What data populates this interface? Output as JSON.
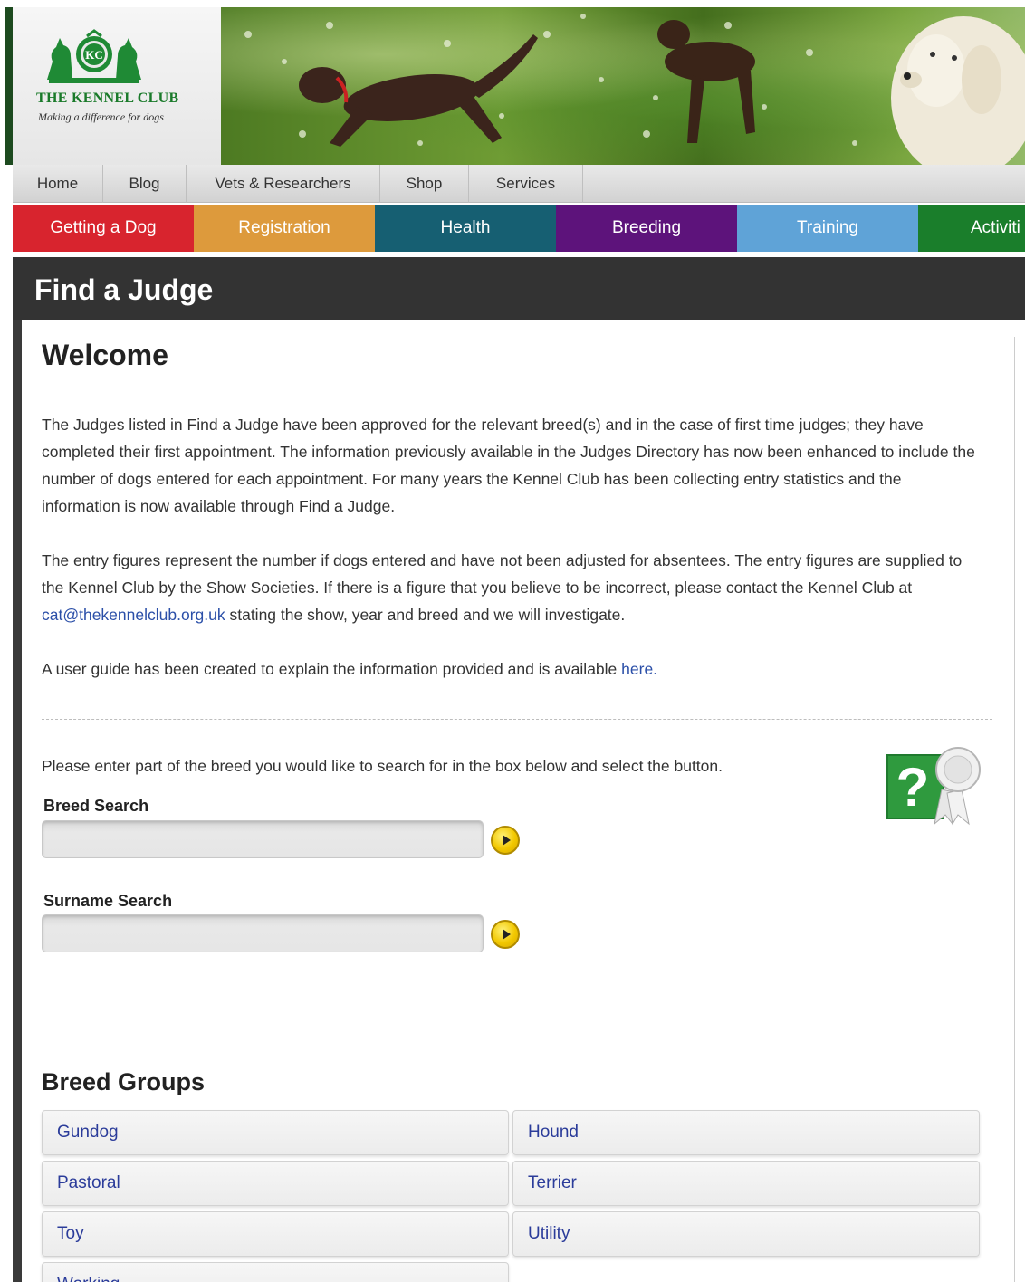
{
  "brand": {
    "name": "THE KENNEL CLUB",
    "tagline": "Making a difference for dogs",
    "emblem_initials": "KC"
  },
  "top_nav": [
    {
      "label": "Home",
      "width": 100
    },
    {
      "label": "Blog",
      "width": 92
    },
    {
      "label": "Vets & Researchers",
      "width": 214
    },
    {
      "label": "Shop",
      "width": 98
    },
    {
      "label": "Services",
      "width": 126
    }
  ],
  "color_nav": [
    {
      "label": "Getting a Dog",
      "color": "#d8242e"
    },
    {
      "label": "Registration",
      "color": "#dd9a3c"
    },
    {
      "label": "Health",
      "color": "#165f72"
    },
    {
      "label": "Breeding",
      "color": "#5d137b"
    },
    {
      "label": "Training",
      "color": "#5fa3d7"
    },
    {
      "label": "Activiti",
      "color": "#1a7e2b"
    }
  ],
  "page": {
    "title": "Find a Judge",
    "welcome_heading": "Welcome",
    "para1": "The Judges listed in Find a Judge have been approved for the relevant breed(s) and in the case of first time judges; they have completed their first appointment. The information previously available in the Judges Directory has now been enhanced to include the number of dogs entered for each appointment. For many years the Kennel Club has been collecting entry statistics and the information is now available through Find a Judge.",
    "para2_before": "The entry figures represent the number if dogs entered and have not been adjusted for absentees. The entry figures are supplied to the Kennel Club by the Show Societies. If there is a figure that you believe to be incorrect, please contact the Kennel Club at ",
    "para2_email": "cat@thekennelclub.org.uk",
    "para2_after": " stating the show, year and breed and we will investigate.",
    "para3_before": "A user guide has been created to explain the information provided and is available ",
    "para3_link": "here."
  },
  "search": {
    "intro": "Please enter part of the breed you would like to search for in the box below and select the button.",
    "breed_label": "Breed Search",
    "breed_value": "",
    "surname_label": "Surname Search",
    "surname_value": ""
  },
  "breed_groups": {
    "title": "Breed Groups",
    "items": [
      "Gundog",
      "Hound",
      "Pastoral",
      "Terrier",
      "Toy",
      "Utility",
      "Working"
    ]
  }
}
